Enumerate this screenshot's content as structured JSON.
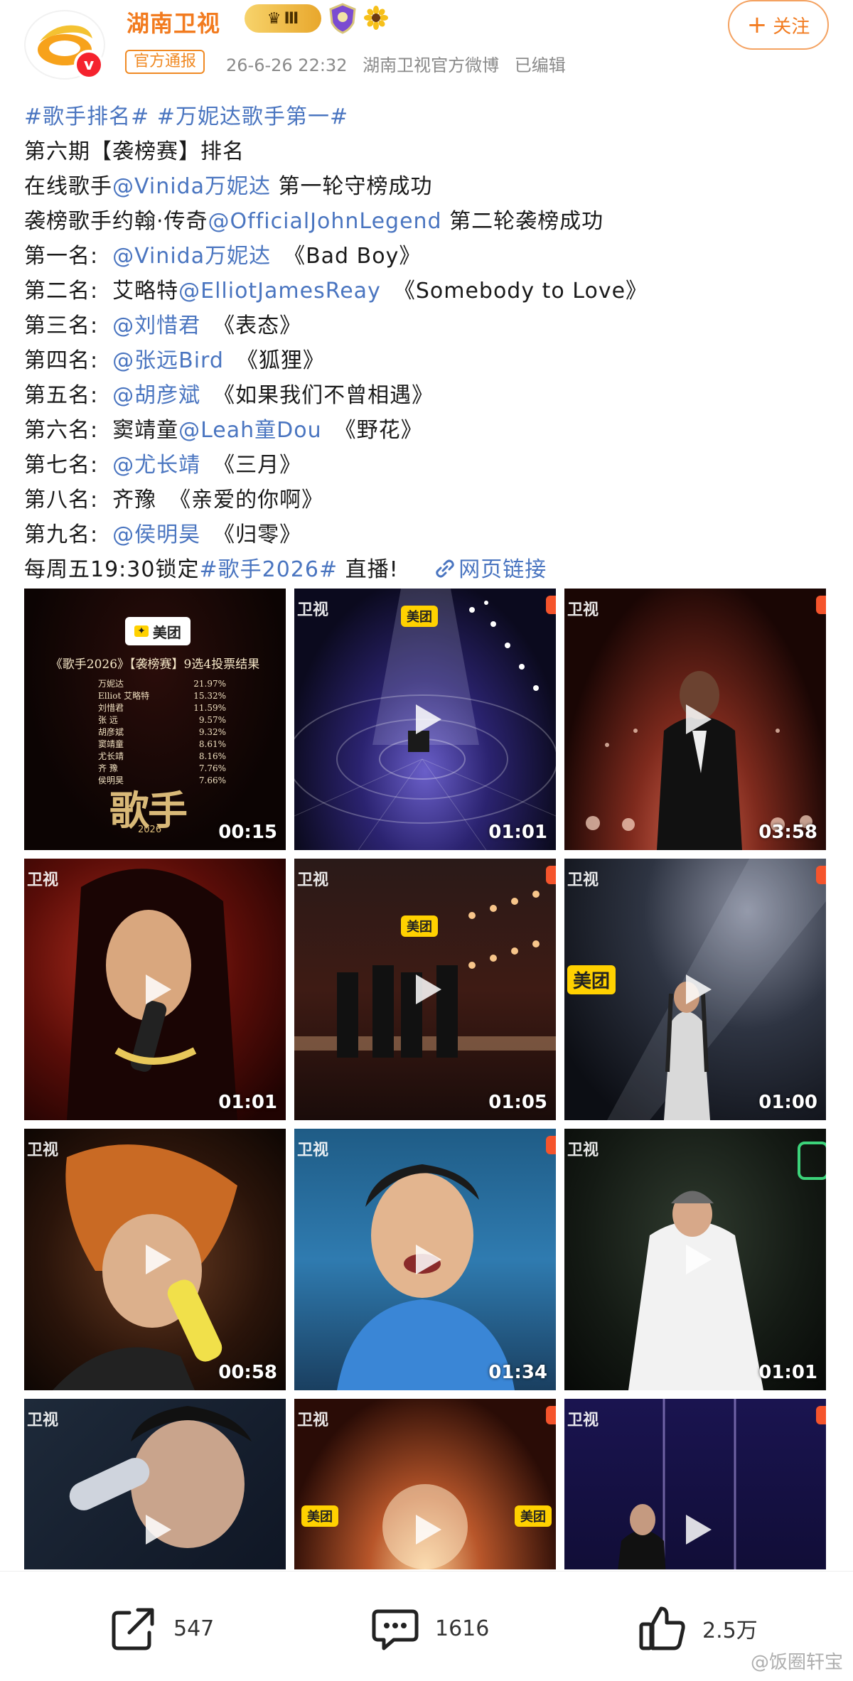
{
  "header": {
    "username": "湖南卫视",
    "level_badge": "Ⅲ",
    "official_tag": "官方通报",
    "timestamp": "26-6-26 22:32",
    "source": "湖南卫视官方微博",
    "edited": "已编辑",
    "follow_label": "关注",
    "verified_mark": "v"
  },
  "post": {
    "hashtags": "#歌手排名# #万妮达歌手第一#",
    "line_title": "第六期【袭榜赛】排名",
    "line_online_prefix": "在线歌手",
    "line_online_mention": "@Vinida万妮达",
    "line_online_suffix": " 第一轮守榜成功",
    "line_challenger_prefix": "袭榜歌手约翰·传奇",
    "line_challenger_mention": "@OfficialJohnLegend",
    "line_challenger_suffix": " 第二轮袭榜成功",
    "rankings": [
      {
        "rank": "第一名:",
        "name_plain": "",
        "mention": "@Vinida万妮达",
        "song": "《Bad Boy》"
      },
      {
        "rank": "第二名:",
        "name_plain": "艾略特",
        "mention": "@ElliotJamesReay",
        "song": "《Somebody to Love》"
      },
      {
        "rank": "第三名:",
        "name_plain": "",
        "mention": "@刘惜君",
        "song": "《表态》"
      },
      {
        "rank": "第四名:",
        "name_plain": "",
        "mention": "@张远Bird",
        "song": "《狐狸》"
      },
      {
        "rank": "第五名:",
        "name_plain": "",
        "mention": "@胡彦斌",
        "song": "《如果我们不曾相遇》"
      },
      {
        "rank": "第六名:",
        "name_plain": "窦靖童",
        "mention": "@Leah童Dou",
        "song": "《野花》"
      },
      {
        "rank": "第七名:",
        "name_plain": "",
        "mention": "@尤长靖",
        "song": "《三月》"
      },
      {
        "rank": "第八名:",
        "name_plain": "齐豫",
        "mention": "",
        "song": "《亲爱的你啊》"
      },
      {
        "rank": "第九名:",
        "name_plain": "",
        "mention": "@侯明昊",
        "song": "《归零》"
      }
    ],
    "footer_prefix": "每周五19:30锁定",
    "footer_tag": "#歌手2026#",
    "footer_suffix": " 直播!",
    "web_link_label": "网页链接"
  },
  "media": {
    "vote_panel": {
      "sponsor": "美团",
      "title": "《歌手2026》【袭榜赛】9选4投票结果",
      "rows": [
        {
          "name": "万妮达",
          "pct": "21.97%"
        },
        {
          "name": "Elliot 艾略特",
          "pct": "15.32%"
        },
        {
          "name": "刘惜君",
          "pct": "11.59%"
        },
        {
          "name": "张 远",
          "pct": "9.57%"
        },
        {
          "name": "胡彦斌",
          "pct": "9.32%"
        },
        {
          "name": "窦靖童",
          "pct": "8.61%"
        },
        {
          "name": "尤长靖",
          "pct": "8.16%"
        },
        {
          "name": "齐 豫",
          "pct": "7.76%"
        },
        {
          "name": "侯明昊",
          "pct": "7.66%"
        }
      ],
      "brand": "歌手",
      "brand_sub": "2026"
    },
    "channel_tag": "卫视",
    "sponsor_tag": "美团",
    "durations": [
      "00:15",
      "01:01",
      "03:58",
      "01:01",
      "01:05",
      "01:00",
      "00:58",
      "01:34",
      "01:01",
      "",
      "",
      ""
    ]
  },
  "actions": {
    "share_count": "547",
    "comment_count": "1616",
    "like_count": "2.5万"
  },
  "watermark": "@饭圈轩宝",
  "colors": {
    "brand_orange": "#f27b1f",
    "link_blue": "#4a75c0",
    "verified_red": "#f5222d"
  }
}
